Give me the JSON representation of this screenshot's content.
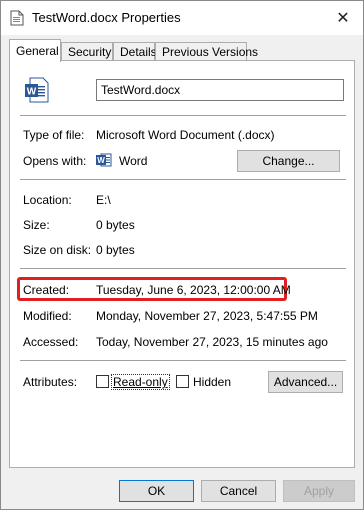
{
  "window": {
    "title": "TestWord.docx Properties",
    "close_glyph": "✕"
  },
  "tabs": [
    {
      "label": "General",
      "active": true
    },
    {
      "label": "Security",
      "active": false
    },
    {
      "label": "Details",
      "active": false
    },
    {
      "label": "Previous Versions",
      "active": false
    }
  ],
  "file": {
    "name": "TestWord.docx",
    "icon": "word-document-icon"
  },
  "type": {
    "label": "Type of file:",
    "value": "Microsoft Word Document (.docx)"
  },
  "opens": {
    "label": "Opens with:",
    "value": "Word",
    "icon": "word-app-icon",
    "button": "Change..."
  },
  "location": {
    "label": "Location:",
    "value": "E:\\"
  },
  "size": {
    "label": "Size:",
    "value": "0 bytes"
  },
  "size_on_disk": {
    "label": "Size on disk:",
    "value": "0 bytes"
  },
  "created": {
    "label": "Created:",
    "value": "Tuesday, June 6, 2023, 12:00:00 AM",
    "highlight_color": "#e02020"
  },
  "modified": {
    "label": "Modified:",
    "value": "Monday, November 27, 2023, 5:47:55 PM"
  },
  "accessed": {
    "label": "Accessed:",
    "value": "Today, November 27, 2023, 15 minutes ago"
  },
  "attributes": {
    "label": "Attributes:",
    "readonly_label": "Read-only",
    "readonly_checked": false,
    "hidden_label": "Hidden",
    "hidden_checked": false,
    "advanced_button": "Advanced..."
  },
  "footer": {
    "ok": "OK",
    "cancel": "Cancel",
    "apply": "Apply"
  },
  "colors": {
    "word_blue": "#2b579a",
    "accent": "#0078d7"
  }
}
